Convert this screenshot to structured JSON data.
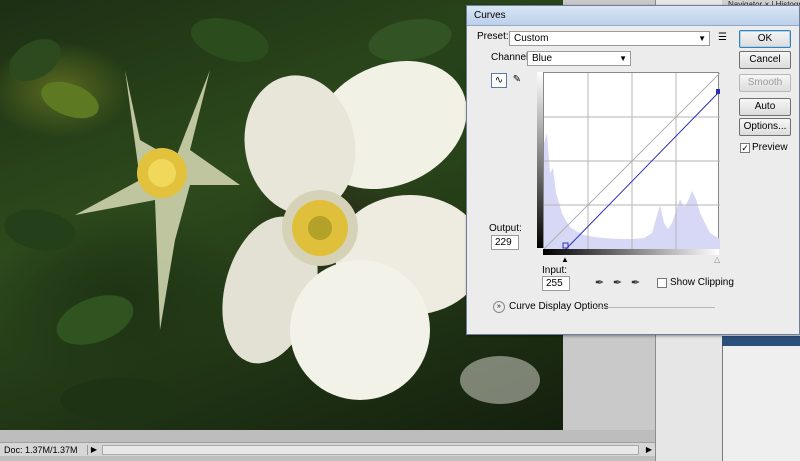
{
  "statusbar": {
    "doc_info": "Doc: 1.37M/1.37M"
  },
  "right_panel": {
    "tabs_text": "Navigator × | Histogr"
  },
  "curves": {
    "title": "Curves",
    "preset_label": "Preset:",
    "preset_value": "Custom",
    "channel_label": "Channel:",
    "channel_value": "Blue",
    "output_label": "Output:",
    "output_value": "229",
    "input_label": "Input:",
    "input_value": "255",
    "show_clipping_label": "Show Clipping",
    "curve_display_options": "Curve Display Options",
    "buttons": {
      "ok": "OK",
      "cancel": "Cancel",
      "smooth": "Smooth",
      "auto": "Auto",
      "options": "Options..."
    },
    "preview_label": "Preview",
    "preview_checked": true,
    "histogram_color": "#d7d8f5",
    "curve_color": "#2b2fb8",
    "icons": [
      "curve-point-tool-icon",
      "pencil-tool-icon",
      "preset-menu-icon",
      "black-eyedropper-icon",
      "gray-eyedropper-icon",
      "white-eyedropper-icon",
      "expand-options-icon"
    ]
  }
}
